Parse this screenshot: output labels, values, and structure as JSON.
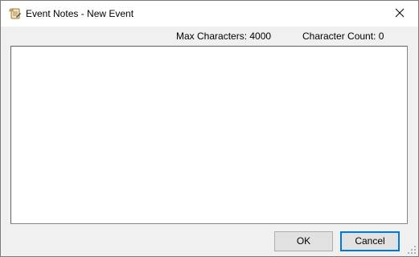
{
  "window": {
    "title": "Event Notes - New Event",
    "app_icon": "notes-scroll-icon",
    "close_icon": "close-icon"
  },
  "status": {
    "max_characters_label": "Max Characters: 4000",
    "character_count_label": "Character Count: 0"
  },
  "notes": {
    "value": ""
  },
  "buttons": {
    "ok_label": "OK",
    "cancel_label": "Cancel"
  },
  "colors": {
    "focus_border": "#0078d7",
    "dialog_background": "#f0f0f0",
    "button_background": "#e1e1e1"
  }
}
